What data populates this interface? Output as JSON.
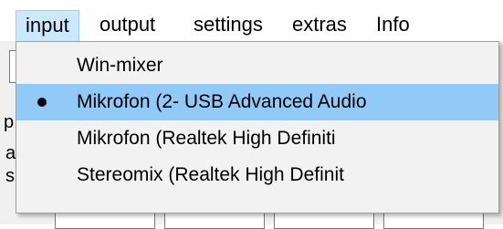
{
  "menubar": {
    "items": [
      {
        "label": "input"
      },
      {
        "label": "output"
      },
      {
        "label": "settings"
      },
      {
        "label": "extras"
      },
      {
        "label": "Info"
      }
    ]
  },
  "dropdown": {
    "items": [
      {
        "label": "Win-mixer",
        "selected": false
      },
      {
        "label": "Mikrofon (2- USB Advanced Audio",
        "selected": true
      },
      {
        "label": "Mikrofon (Realtek High Definiti",
        "selected": false
      },
      {
        "label": "Stereomix (Realtek High Definit",
        "selected": false
      }
    ]
  },
  "colors": {
    "menu_active_bg": "#cce8ff",
    "selected_item_bg": "#91c9f7",
    "dropdown_bg": "#f2f2f2"
  }
}
